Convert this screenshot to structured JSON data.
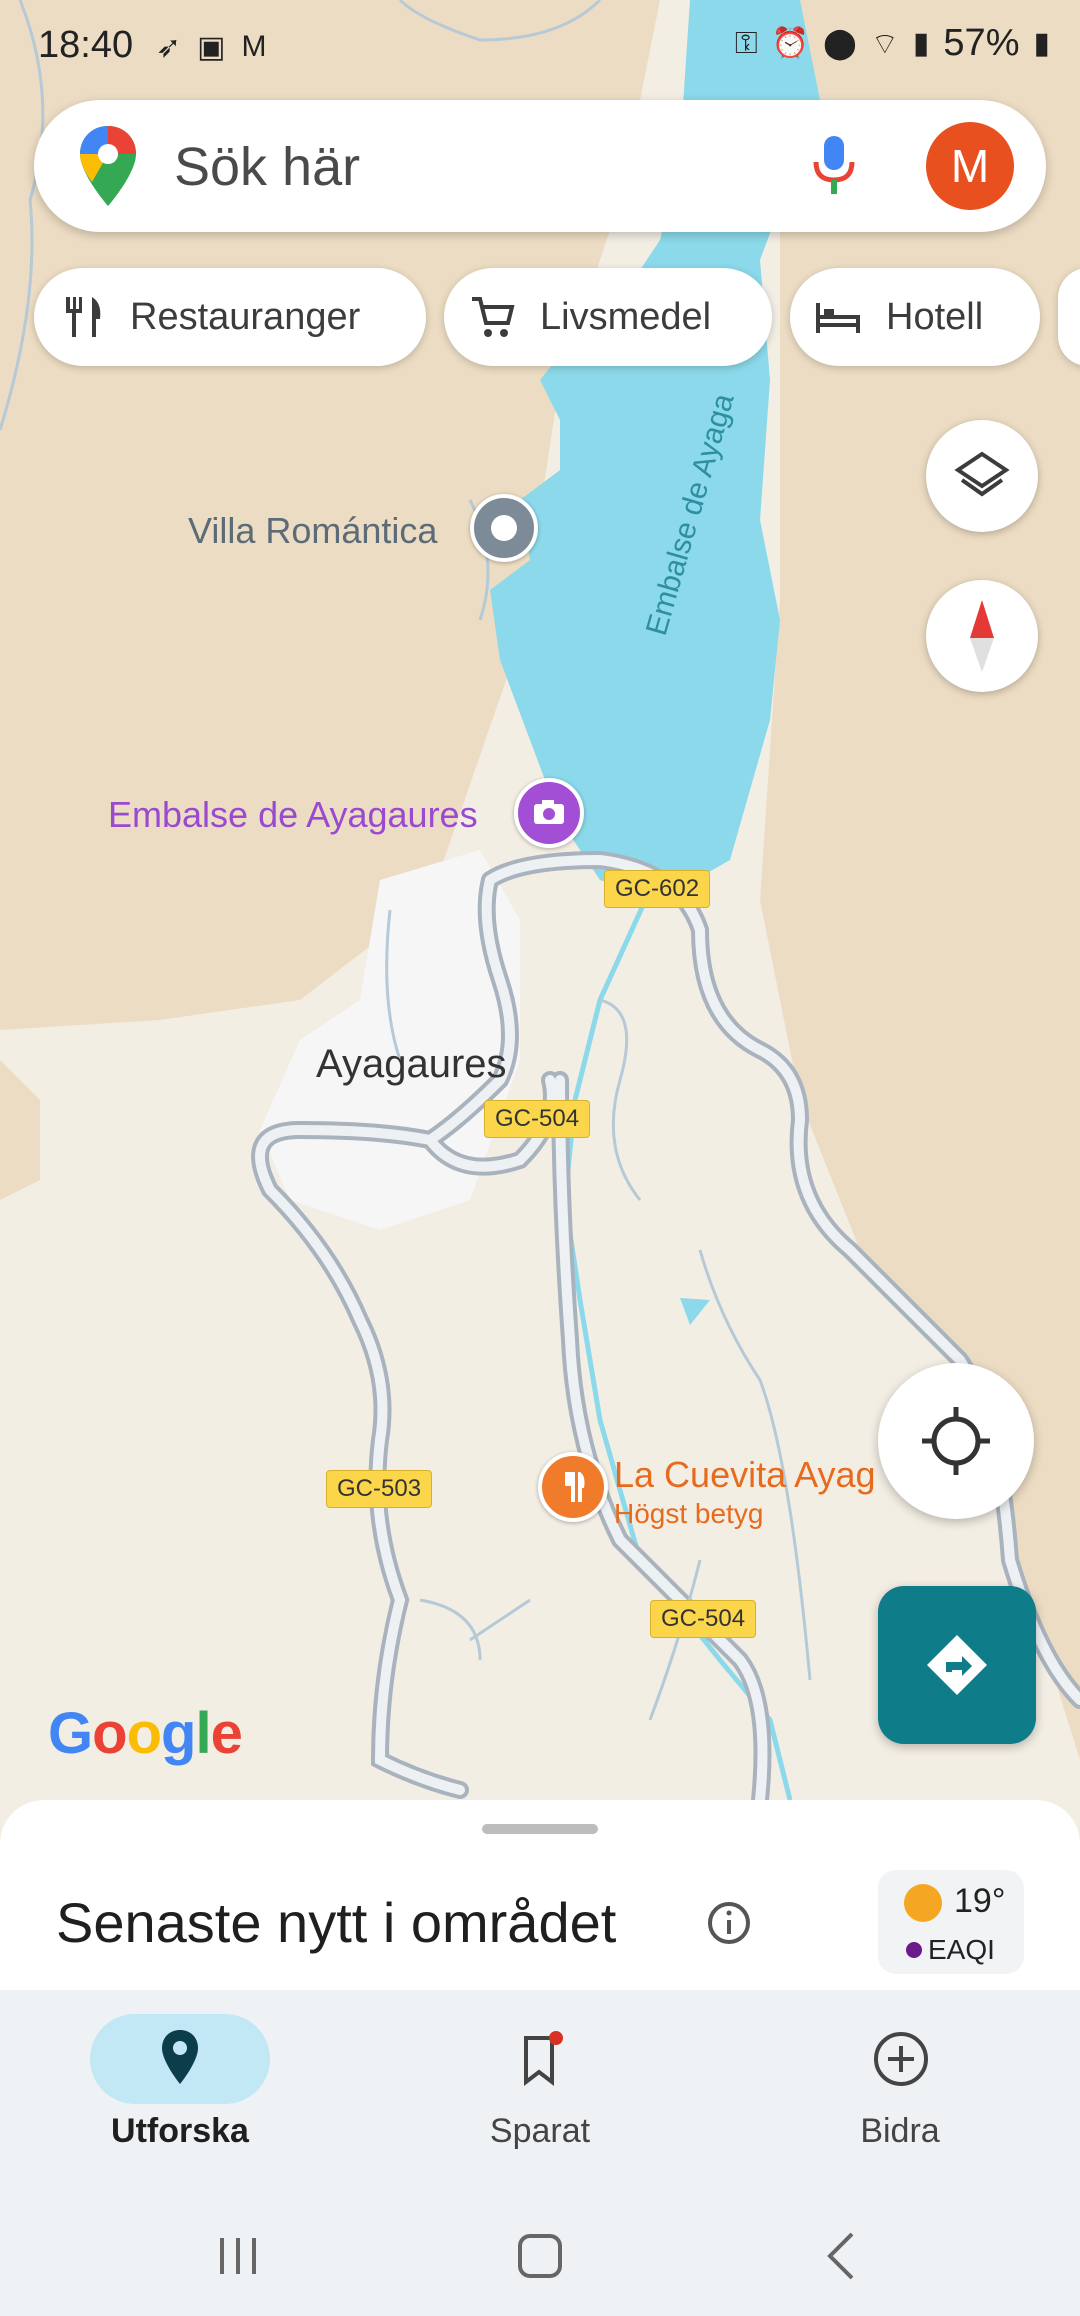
{
  "status_bar": {
    "time": "18:40",
    "battery": "57%"
  },
  "search": {
    "placeholder": "Sök här",
    "avatar_letter": "M"
  },
  "chips": [
    {
      "label": "Restauranger",
      "icon": "fork-knife-icon"
    },
    {
      "label": "Livsmedel",
      "icon": "cart-icon"
    },
    {
      "label": "Hotell",
      "icon": "bed-icon"
    }
  ],
  "map": {
    "labels": {
      "villa": "Villa Romántica",
      "reservoir_poi": "Embalse de Ayagaures",
      "reservoir_water": "Embalse de Ayaga",
      "town": "Ayagaures",
      "restaurant": "La Cuevita Ayag",
      "restaurant_sub": "Högst betyg"
    },
    "roads": [
      "GC-602",
      "GC-504",
      "GC-503",
      "GC-504"
    ],
    "logo": "Google"
  },
  "sheet": {
    "title": "Senaste nytt i området",
    "weather_temp": "19°",
    "weather_aqi": "EAQI"
  },
  "nav": {
    "items": [
      {
        "label": "Utforska",
        "icon": "explore-pin-icon",
        "active": true
      },
      {
        "label": "Sparat",
        "icon": "bookmark-icon",
        "active": false
      },
      {
        "label": "Bidra",
        "icon": "add-circle-icon",
        "active": false
      }
    ]
  },
  "colors": {
    "water": "#8bd9ea",
    "accent": "#0f7c8a",
    "avatar": "#e8501f",
    "road_shield": "#fbd64a",
    "poi_purple": "#a24fd6",
    "poi_orange": "#f07b2b"
  }
}
